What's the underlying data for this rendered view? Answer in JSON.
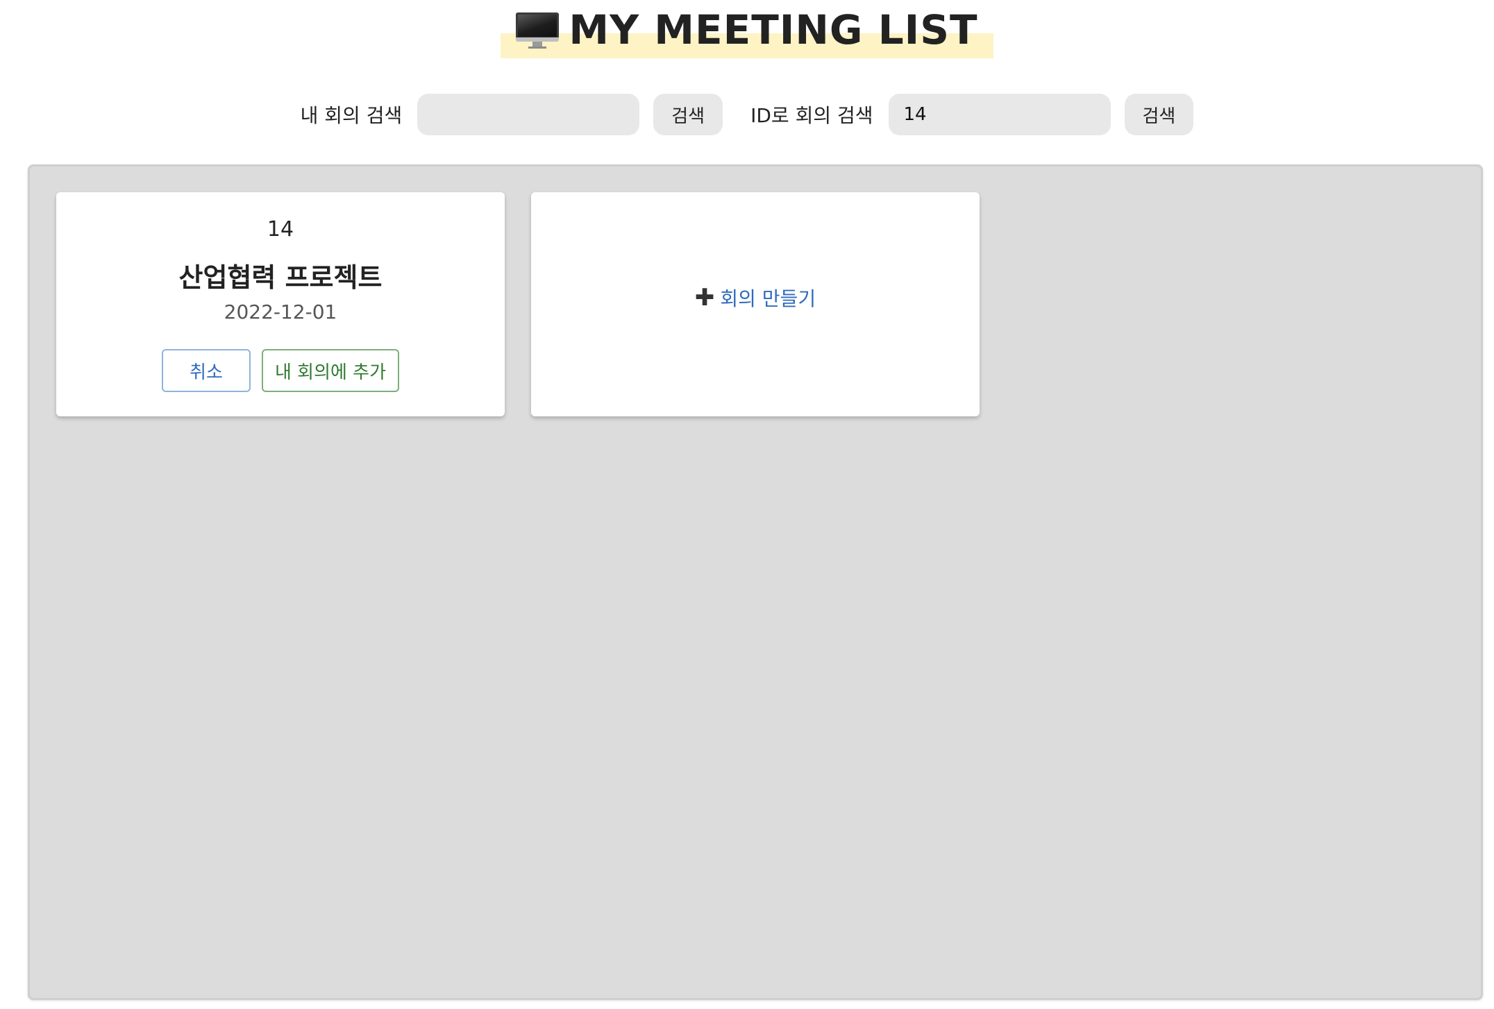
{
  "header": {
    "title": "MY MEETING LIST",
    "icon": "desktop-computer-icon",
    "highlight_color": "#fdf3c4"
  },
  "search": {
    "my_meeting": {
      "label": "내 회의 검색",
      "value": "",
      "button_label": "검색"
    },
    "by_id": {
      "label": "ID로 회의 검색",
      "value": "14",
      "button_label": "검색"
    }
  },
  "meetings": [
    {
      "id": "14",
      "name": "산업협력 프로젝트",
      "date": "2022-12-01",
      "cancel_label": "취소",
      "add_label": "내 회의에 추가"
    }
  ],
  "create_card": {
    "icon": "plus-icon",
    "label": "회의 만들기"
  },
  "colors": {
    "board_background": "#dcdcdc",
    "link_blue": "#2e6bbd",
    "add_green": "#2f7a2f"
  }
}
